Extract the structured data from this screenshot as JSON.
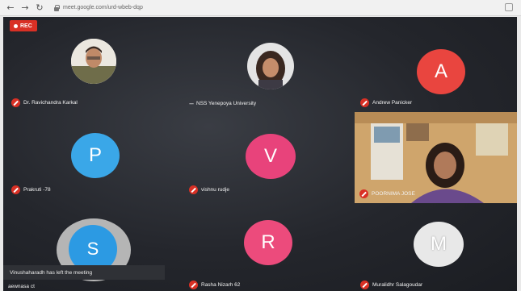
{
  "browser": {
    "url": "meet.google.com/urd-wbeb-dqp",
    "right_text": "",
    "back_icon": "back-arrow-icon",
    "forward_icon": "forward-arrow-icon",
    "reload_icon": "reload-icon"
  },
  "meeting": {
    "rec_label": "REC",
    "colors": {
      "rec": "#d93025",
      "mic_off": "#d93025"
    }
  },
  "participants": [
    {
      "name": "Dr. Ravichandra Karkal",
      "type": "photo"
    },
    {
      "name": "NSS Yenepoya University",
      "type": "photo",
      "prefix": "---"
    },
    {
      "name": "Andrew Panicker",
      "type": "letter",
      "letter": "A",
      "color": "#e9453f"
    },
    {
      "name": "Prakruti -78",
      "type": "letter",
      "letter": "P",
      "color": "#3aa7e8"
    },
    {
      "name": "vishnu rudje",
      "type": "letter",
      "letter": "V",
      "color": "#e8437b"
    },
    {
      "name": "POORNIMA JOSE",
      "type": "video"
    },
    {
      "name": "",
      "type": "letter",
      "letter": "S",
      "color": "#2c9ae3"
    },
    {
      "name": "Rasha Nizarh 62",
      "type": "letter",
      "letter": "R",
      "color": "#ec4b7c"
    },
    {
      "name": "Muralidhr Salagoudar",
      "type": "letter",
      "letter": "M",
      "color": "#e8e8e8"
    }
  ],
  "toast": {
    "text": "Vinushaharadh has left the meeting"
  },
  "bottom": {
    "name": "aewnasa ct"
  }
}
